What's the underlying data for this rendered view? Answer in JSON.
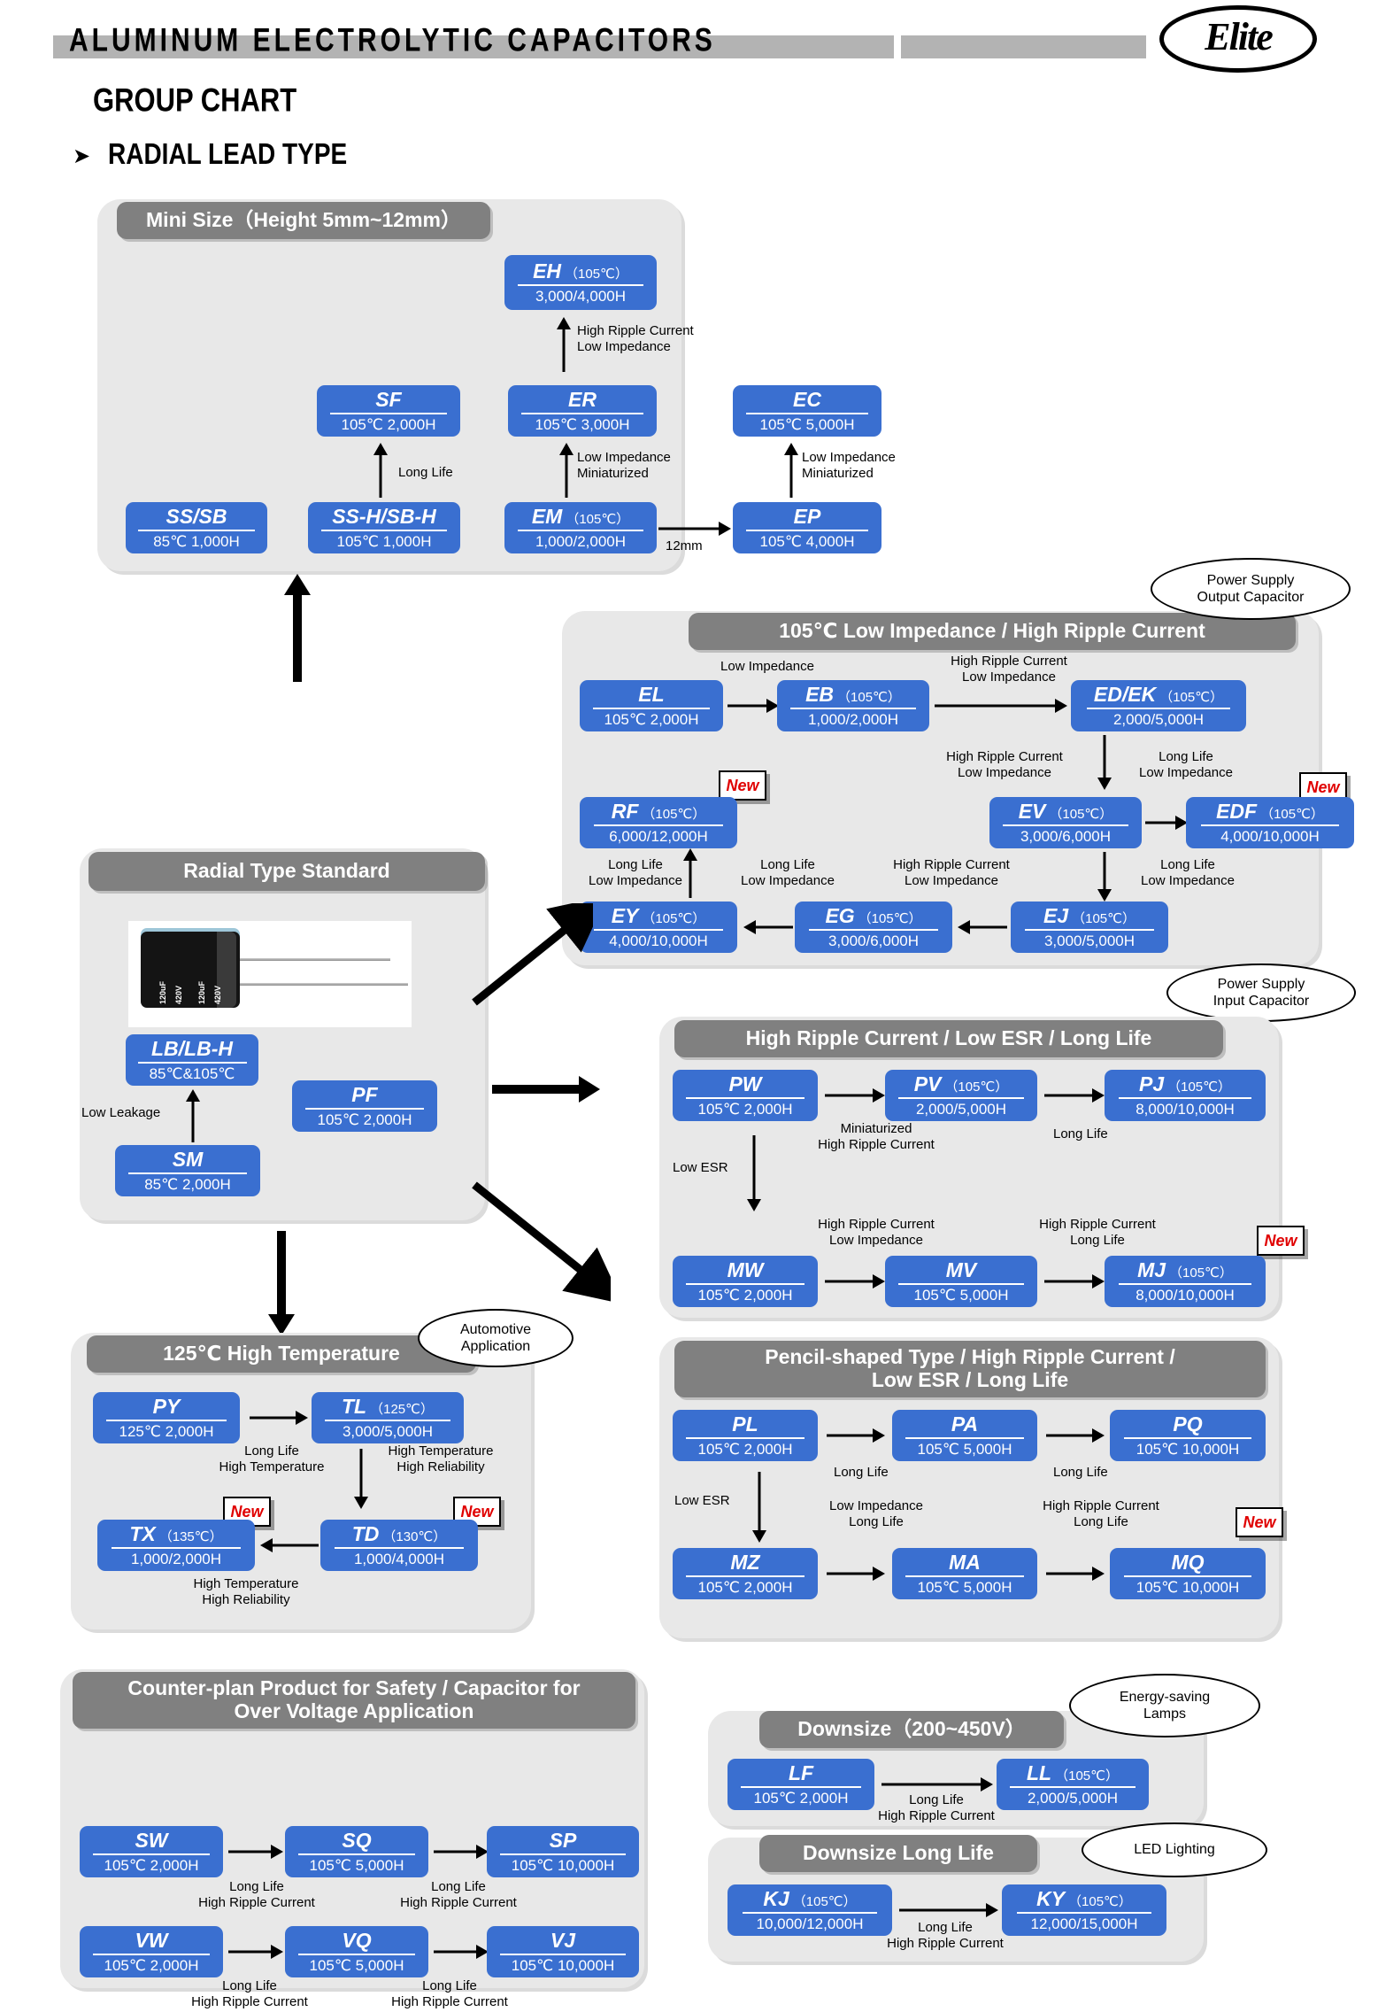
{
  "header": {
    "title": "ALUMINUM ELECTROLYTIC CAPACITORS",
    "logo_text": "Elite",
    "group_chart": "GROUP CHART",
    "radial_lead_type": "RADIAL LEAD TYPE",
    "bullet": "➤"
  },
  "labels": {
    "new": "New",
    "low_impedance": "Low Impedance",
    "high_ripple_current": "High Ripple Current",
    "long_life": "Long Life",
    "miniaturized": "Miniaturized",
    "low_esr": "Low ESR",
    "low_leakage": "Low Leakage",
    "high_temperature": "High Temperature",
    "high_reliability": "High Reliability",
    "twelve_mm": "12mm",
    "hrc_li_1": "High Ripple Current",
    "hrc_li_2": "Low Impedance",
    "ll_li_1": "Long Life",
    "ll_li_2": "Low Impedance",
    "mini_hrc": "High Ripple Current",
    "mini_li": "Low Impedance",
    "ll_hrc_1": "Long Life",
    "ll_hrc_2": "High Ripple Current",
    "min_hrc_1": "Miniaturized",
    "min_hrc_2": "High Ripple Current",
    "hrc_ll_1": "High Ripple Current",
    "hrc_ll_2": "Long Life",
    "li_ll_1": "Low Impedance",
    "li_ll_2": "Long Life",
    "ll_ht_1": "Long Life",
    "ll_ht_2": "High Temperature",
    "ht_hr_1": "High Temperature",
    "ht_hr_2": "High Reliability",
    "ht_hr_b1": "High Temperature",
    "ht_hr_b2": "High Reliability"
  },
  "callouts": {
    "power_supply_output": "Power Supply\nOutput Capacitor",
    "power_supply_output_l1": "Power Supply",
    "power_supply_output_l2": "Output Capacitor",
    "power_supply_input_l1": "Power Supply",
    "power_supply_input_l2": "Input Capacitor",
    "automotive_l1": "Automotive",
    "automotive_l2": "Application",
    "energy_l1": "Energy-saving",
    "energy_l2": "Lamps",
    "led": "LED Lighting"
  },
  "sections": {
    "mini": {
      "title": "Mini Size（Height 5mm~12mm）",
      "boxes": {
        "eh": {
          "code": "EH",
          "temp": "（105℃）",
          "life": "3,000/4,000H"
        },
        "sf": {
          "code": "SF",
          "temp": "",
          "life": "105℃ 2,000H"
        },
        "er": {
          "code": "ER",
          "temp": "",
          "life": "105℃ 3,000H"
        },
        "ec": {
          "code": "EC",
          "temp": "",
          "life": "105℃ 5,000H"
        },
        "ssb": {
          "code": "SS/SB",
          "temp": "",
          "life": "85℃ 1,000H"
        },
        "sshbh": {
          "code": "SS-H/SB-H",
          "temp": "",
          "life": "105℃ 1,000H"
        },
        "em": {
          "code": "EM",
          "temp": "（105℃）",
          "life": "1,000/2,000H"
        },
        "ep": {
          "code": "EP",
          "temp": "",
          "life": "105℃ 4,000H"
        }
      }
    },
    "lowimp": {
      "title": "105℃ Low Impedance / High Ripple Current",
      "boxes": {
        "el": {
          "code": "EL",
          "temp": "",
          "life": "105℃ 2,000H"
        },
        "eb": {
          "code": "EB",
          "temp": "（105℃）",
          "life": "1,000/2,000H"
        },
        "edek": {
          "code": "ED/EK",
          "temp": "（105℃）",
          "life": "2,000/5,000H"
        },
        "rf": {
          "code": "RF",
          "temp": "（105℃）",
          "life": "6,000/12,000H"
        },
        "ev": {
          "code": "EV",
          "temp": "（105℃）",
          "life": "3,000/6,000H"
        },
        "edf": {
          "code": "EDF",
          "temp": "（105℃）",
          "life": "4,000/10,000H"
        },
        "ey": {
          "code": "EY",
          "temp": "（105℃）",
          "life": "4,000/10,000H"
        },
        "eg": {
          "code": "EG",
          "temp": "（105℃）",
          "life": "3,000/6,000H"
        },
        "ej": {
          "code": "EJ",
          "temp": "（105℃）",
          "life": "3,000/5,000H"
        }
      }
    },
    "standard": {
      "title": "Radial Type Standard",
      "photo_label_1": "120uF",
      "photo_label_2": "420V",
      "boxes": {
        "lb": {
          "code": "LB/LB-H",
          "temp": "",
          "life": "85℃&105℃"
        },
        "pf": {
          "code": "PF",
          "temp": "",
          "life": "105℃ 2,000H"
        },
        "sm": {
          "code": "SM",
          "temp": "",
          "life": "85℃ 2,000H"
        }
      }
    },
    "hrc": {
      "title": "High Ripple Current / Low ESR / Long Life",
      "boxes": {
        "pw": {
          "code": "PW",
          "temp": "",
          "life": "105℃ 2,000H"
        },
        "pv": {
          "code": "PV",
          "temp": "（105℃）",
          "life": "2,000/5,000H"
        },
        "pj": {
          "code": "PJ",
          "temp": "（105℃）",
          "life": "8,000/10,000H"
        },
        "mw": {
          "code": "MW",
          "temp": "",
          "life": "105℃ 2,000H"
        },
        "mv": {
          "code": "MV",
          "temp": "",
          "life": "105℃ 5,000H"
        },
        "mj": {
          "code": "MJ",
          "temp": "（105℃）",
          "life": "8,000/10,000H"
        }
      }
    },
    "hightemp": {
      "title": "125℃ High Temperature",
      "boxes": {
        "py": {
          "code": "PY",
          "temp": "",
          "life": "125℃ 2,000H"
        },
        "tl": {
          "code": "TL",
          "temp": "（125℃）",
          "life": "3,000/5,000H"
        },
        "tx": {
          "code": "TX",
          "temp": "（135℃）",
          "life": "1,000/2,000H"
        },
        "td": {
          "code": "TD",
          "temp": "（130℃）",
          "life": "1,000/4,000H"
        }
      }
    },
    "pencil": {
      "title_l1": "Pencil-shaped Type / High Ripple Current /",
      "title_l2": "Low ESR / Long Life",
      "boxes": {
        "pl": {
          "code": "PL",
          "temp": "",
          "life": "105℃ 2,000H"
        },
        "pa": {
          "code": "PA",
          "temp": "",
          "life": "105℃ 5,000H"
        },
        "pq": {
          "code": "PQ",
          "temp": "",
          "life": "105℃ 10,000H"
        },
        "mz": {
          "code": "MZ",
          "temp": "",
          "life": "105℃ 2,000H"
        },
        "ma": {
          "code": "MA",
          "temp": "",
          "life": "105℃ 5,000H"
        },
        "mq": {
          "code": "MQ",
          "temp": "",
          "life": "105℃ 10,000H"
        }
      }
    },
    "counter": {
      "title_l1": "Counter-plan Product for Safety / Capacitor for",
      "title_l2": "Over Voltage Application",
      "boxes": {
        "sw": {
          "code": "SW",
          "temp": "",
          "life": "105℃ 2,000H"
        },
        "sq": {
          "code": "SQ",
          "temp": "",
          "life": "105℃ 5,000H"
        },
        "sp": {
          "code": "SP",
          "temp": "",
          "life": "105℃ 10,000H"
        },
        "vw": {
          "code": "VW",
          "temp": "",
          "life": "105℃ 2,000H"
        },
        "vq": {
          "code": "VQ",
          "temp": "",
          "life": "105℃ 5,000H"
        },
        "vj": {
          "code": "VJ",
          "temp": "",
          "life": "105℃ 10,000H"
        }
      }
    },
    "downsize": {
      "title": "Downsize（200~450V）",
      "boxes": {
        "lf": {
          "code": "LF",
          "temp": "",
          "life": "105℃ 2,000H"
        },
        "ll": {
          "code": "LL",
          "temp": "（105℃）",
          "life": "2,000/5,000H"
        }
      }
    },
    "downsizell": {
      "title": "Downsize Long Life",
      "boxes": {
        "kj": {
          "code": "KJ",
          "temp": "（105℃）",
          "life": "10,000/12,000H"
        },
        "ky": {
          "code": "KY",
          "temp": "（105℃）",
          "life": "12,000/15,000H"
        }
      }
    }
  },
  "colors": {
    "box": "#3a6fd0",
    "panel": "#e8e8e8",
    "header": "#808080",
    "new": "#e00000"
  }
}
